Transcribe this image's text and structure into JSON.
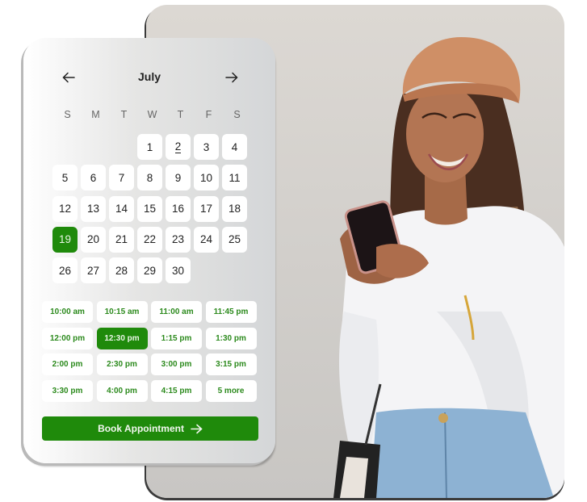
{
  "calendar": {
    "month": "July",
    "prev_icon": "arrow-left-icon",
    "next_icon": "arrow-right-icon",
    "weekdays": [
      "S",
      "M",
      "T",
      "W",
      "T",
      "F",
      "S"
    ],
    "first_weekday_index": 3,
    "days_in_month": 30,
    "today": 2,
    "selected_day": 19,
    "days": [
      "1",
      "2",
      "3",
      "4",
      "5",
      "6",
      "7",
      "8",
      "9",
      "10",
      "11",
      "12",
      "13",
      "14",
      "15",
      "16",
      "17",
      "18",
      "19",
      "20",
      "21",
      "22",
      "23",
      "24",
      "25",
      "26",
      "27",
      "28",
      "29",
      "30"
    ]
  },
  "time_slots": {
    "items": [
      "10:00 am",
      "10:15 am",
      "11:00 am",
      "11:45 pm",
      "12:00 pm",
      "12:30 pm",
      "1:15 pm",
      "1:30 pm",
      "2:00 pm",
      "2:30 pm",
      "3:00 pm",
      "3:15 pm",
      "3:30 pm",
      "4:00 pm",
      "4:15 pm",
      "5 more"
    ],
    "selected": "12:30 pm"
  },
  "book_button": {
    "label": "Book Appointment",
    "icon": "arrow-right-icon"
  },
  "photo": {
    "description": "Smiling woman in tan cap and white blouse looking at smartphone"
  },
  "colors": {
    "accent": "#1f8a0b",
    "slot_text": "#2c8a1d"
  }
}
